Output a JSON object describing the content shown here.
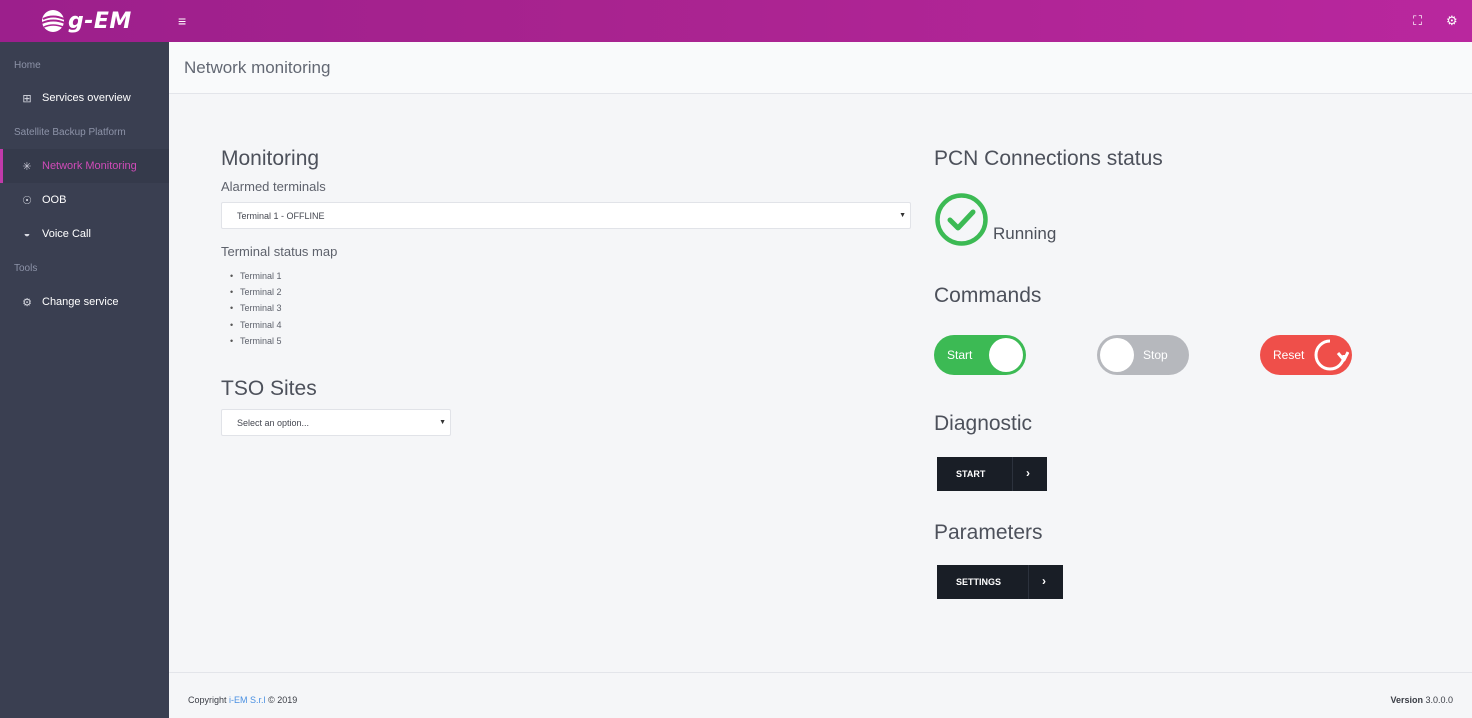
{
  "brand": {
    "logo_text": "g-EM"
  },
  "colors": {
    "accent": "#a8238f",
    "sidebar_bg": "#3a3f51",
    "success": "#3cba54",
    "danger": "#ef4f4a",
    "muted": "#b6b8bd",
    "dark_button": "#191e26"
  },
  "topbar": {
    "menu_icon": "hamburger-icon",
    "fullscreen_icon": "expand-icon",
    "settings_icon": "gears-icon"
  },
  "sidebar": {
    "sections": [
      "Home",
      "Satellite Backup Platform",
      "Tools"
    ],
    "items": [
      {
        "label": "Services overview",
        "icon": "grid-icon"
      },
      {
        "label": "Network Monitoring",
        "icon": "network-icon",
        "active": true
      },
      {
        "label": "OOB",
        "icon": "antenna-icon"
      },
      {
        "label": "Voice Call",
        "icon": "satellite-icon"
      },
      {
        "label": "Change service",
        "icon": "gears-icon"
      }
    ]
  },
  "page": {
    "title": "Network monitoring"
  },
  "monitoring": {
    "heading": "Monitoring",
    "alarmed_label": "Alarmed terminals",
    "alarmed_selected": "Terminal 1 - OFFLINE",
    "status_map_label": "Terminal status map",
    "terminals": [
      "Terminal 1",
      "Terminal 2",
      "Terminal 3",
      "Terminal 4",
      "Terminal 5"
    ]
  },
  "tso": {
    "heading": "TSO Sites",
    "placeholder": "Select an option..."
  },
  "pcn": {
    "heading": "PCN Connections status",
    "status": "Running"
  },
  "commands": {
    "heading": "Commands",
    "start": "Start",
    "stop": "Stop",
    "reset": "Reset"
  },
  "diagnostic": {
    "heading": "Diagnostic",
    "button": "START"
  },
  "parameters": {
    "heading": "Parameters",
    "button": "SETTINGS"
  },
  "footer": {
    "copyright_prefix": "Copyright",
    "company": "i-EM S.r.l",
    "copyright_suffix": "© 2019",
    "version_label": "Version",
    "version": "3.0.0.0"
  }
}
